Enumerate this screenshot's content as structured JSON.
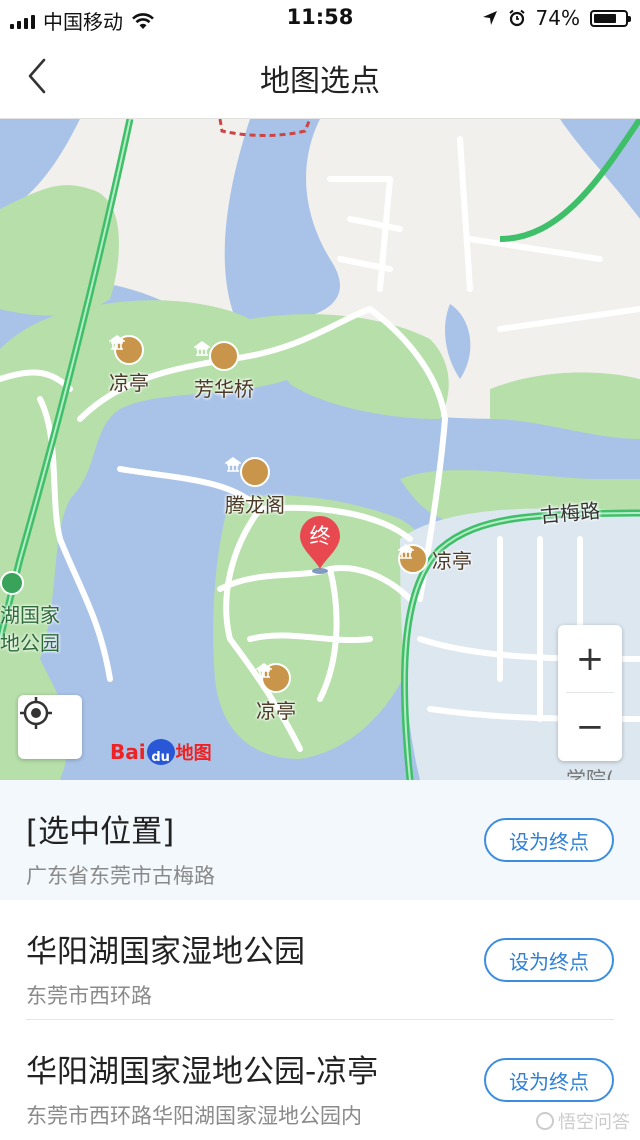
{
  "status_bar": {
    "carrier": "中国移动",
    "time": "11:58",
    "battery": "74%",
    "battery_level": 0.74
  },
  "nav": {
    "title": "地图选点"
  },
  "map": {
    "pois": [
      {
        "label": "凉亭",
        "icon": "pavilion-icon"
      },
      {
        "label": "芳华桥",
        "icon": "bridge-icon"
      },
      {
        "label": "腾龙阁",
        "icon": "tower-icon"
      },
      {
        "label": "凉亭",
        "icon": "pavilion-icon"
      },
      {
        "label": "凉亭",
        "icon": "pavilion-icon"
      }
    ],
    "road_label": "古梅路",
    "park_label_line1": "湖国家",
    "park_label_line2": "地公园",
    "end_marker": "终",
    "zoom_in": "+",
    "zoom_out": "−",
    "logo_bai": "Bai",
    "logo_du": "du",
    "logo_ditu": "地图",
    "edge_label": "学院("
  },
  "results": [
    {
      "name": "[选中位置]",
      "address": "广东省东莞市古梅路",
      "button": "设为终点"
    },
    {
      "name": "华阳湖国家湿地公园",
      "address": "东莞市西环路",
      "button": "设为终点"
    },
    {
      "name": "华阳湖国家湿地公园-凉亭",
      "address": "东莞市西环路华阳湖国家湿地公园内",
      "button": "设为终点"
    }
  ],
  "watermark": "悟空问答",
  "colors": {
    "water": "#a9c3e8",
    "park": "#b6dfa9",
    "land": "#f2f0ec",
    "road": "#ffffff",
    "highway": "#3fbf6a",
    "marker": "#e8484f",
    "button": "#3c8de0"
  }
}
